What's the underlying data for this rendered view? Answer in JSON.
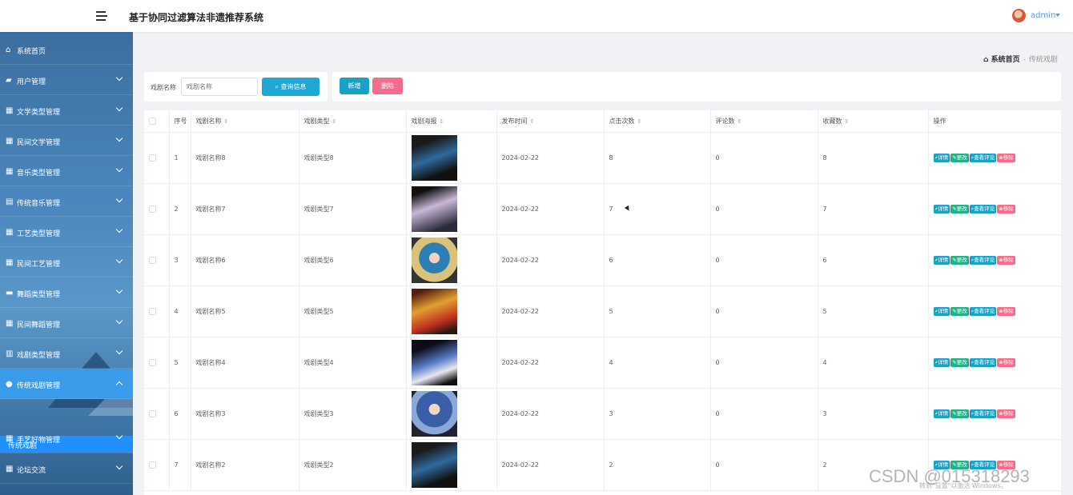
{
  "header": {
    "title": "基于协同过滤算法非遗推荐系统",
    "user": "admin"
  },
  "sidebar": {
    "items": [
      {
        "label": "系统首页",
        "icon": "home-icon"
      },
      {
        "label": "用户管理",
        "icon": "briefcase-icon"
      },
      {
        "label": "文学类型管理",
        "icon": "grid-icon"
      },
      {
        "label": "民间文学管理",
        "icon": "grid-icon"
      },
      {
        "label": "音乐类型管理",
        "icon": "grid-icon"
      },
      {
        "label": "传统音乐管理",
        "icon": "document-icon"
      },
      {
        "label": "工艺类型管理",
        "icon": "grid-icon"
      },
      {
        "label": "民间工艺管理",
        "icon": "grid-icon"
      },
      {
        "label": "舞蹈类型管理",
        "icon": "chat-icon"
      },
      {
        "label": "民间舞蹈管理",
        "icon": "grid-icon"
      },
      {
        "label": "戏剧类型管理",
        "icon": "chart-icon"
      },
      {
        "label": "传统戏剧管理",
        "icon": "location-icon"
      },
      {
        "label": "手艺好物管理",
        "icon": "grid-icon"
      },
      {
        "label": "论坛交流",
        "icon": "grid-icon"
      }
    ],
    "active_sub": "传统戏剧"
  },
  "breadcrumb": {
    "home": "系统首页",
    "current": "传统戏剧"
  },
  "search": {
    "label": "戏剧名称",
    "placeholder": "戏剧名称",
    "button": "查询信息"
  },
  "actions": {
    "add": "新增",
    "delete": "删除"
  },
  "table": {
    "headers": [
      "序号",
      "戏剧名称",
      "戏剧类型",
      "戏剧海报",
      "发布时间",
      "点击次数",
      "评论数",
      "收藏数",
      "操作"
    ],
    "op_labels": {
      "detail": "详情",
      "edit": "更改",
      "view": "查看评论",
      "remove": "移除"
    },
    "rows": [
      {
        "no": "1",
        "name": "戏剧名称8",
        "type": "戏剧类型8",
        "date": "2024-02-22",
        "clicks": "8",
        "comments": "0",
        "favs": "8"
      },
      {
        "no": "2",
        "name": "戏剧名称7",
        "type": "戏剧类型7",
        "date": "2024-02-22",
        "clicks": "7",
        "comments": "0",
        "favs": "7"
      },
      {
        "no": "3",
        "name": "戏剧名称6",
        "type": "戏剧类型6",
        "date": "2024-02-22",
        "clicks": "6",
        "comments": "0",
        "favs": "6"
      },
      {
        "no": "4",
        "name": "戏剧名称5",
        "type": "戏剧类型5",
        "date": "2024-02-22",
        "clicks": "5",
        "comments": "0",
        "favs": "5"
      },
      {
        "no": "5",
        "name": "戏剧名称4",
        "type": "戏剧类型4",
        "date": "2024-02-22",
        "clicks": "4",
        "comments": "0",
        "favs": "4"
      },
      {
        "no": "6",
        "name": "戏剧名称3",
        "type": "戏剧类型3",
        "date": "2024-02-22",
        "clicks": "3",
        "comments": "0",
        "favs": "3"
      },
      {
        "no": "7",
        "name": "戏剧名称2",
        "type": "戏剧类型2",
        "date": "2024-02-22",
        "clicks": "2",
        "comments": "0",
        "favs": "2"
      }
    ]
  },
  "overlay": {
    "watermark": "CSDN @015318293",
    "windows_activation": "转到\"设置\"以激活 Windows。"
  },
  "colors": {
    "accent": "#1fa8d4",
    "danger": "#f56c8c",
    "sidebar_active": "#1e90ff"
  }
}
